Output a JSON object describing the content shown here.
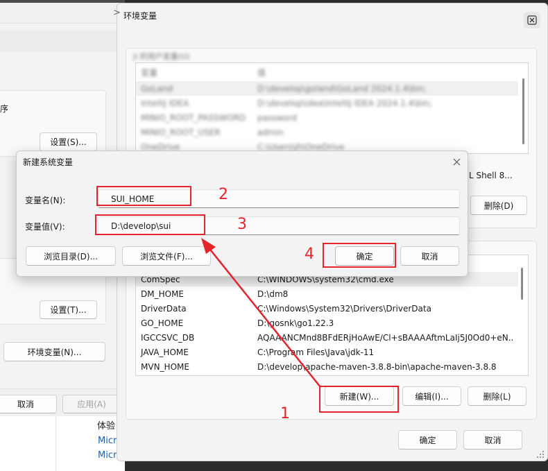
{
  "bg_window": {
    "partial_char": "序",
    "settings_s_label": "设置(S)...",
    "settings_t_label": "设置(T)...",
    "env_vars_label": "环境变量(N)...",
    "cancel_label": "取消",
    "apply_label": "应用(A)"
  },
  "behind_text": {
    "item1": "体验",
    "item2": "Micr",
    "item3": "Micr"
  },
  "env_dialog": {
    "chevron": ">",
    "title": "环境变量",
    "user_group_label": "Ji 的用户变量(U)",
    "user_vars": {
      "col_name": "变量",
      "col_value": "值",
      "rows": [
        {
          "name": "GoLand",
          "value": "D:\\develop\\goland\\GoLand 2024.1.4\\bin;"
        },
        {
          "name": "IntelliJ IDEA",
          "value": "D:\\develop\\idea\\IntelliJ IDEA 2024.1.4\\bin;"
        },
        {
          "name": "MINIO_ROOT_PASSWORD",
          "value": "password"
        },
        {
          "name": "MINIO_ROOT_USER",
          "value": "admin"
        },
        {
          "name": "OneDrive",
          "value": "C:\\Users\\jh\\OneDrive"
        }
      ],
      "partial_row_text": "L Shell 8..."
    },
    "user_delete_label": "删除(D)",
    "sys_vars": {
      "rows": [
        {
          "name": "ComSpec",
          "value": "C:\\WINDOWS\\system32\\cmd.exe"
        },
        {
          "name": "DM_HOME",
          "value": "D:\\dm8"
        },
        {
          "name": "DriverData",
          "value": "C:\\Windows\\System32\\Drivers\\DriverData"
        },
        {
          "name": "GO_HOME",
          "value": "D:\\gosnk\\go1.22.3"
        },
        {
          "name": "IGCCSVC_DB",
          "value": "AQAAANCMnd8BFdERjHoAwE/Cl+sBAAAAftmLaIj5J0Od0+eN..."
        },
        {
          "name": "JAVA_HOME",
          "value": "C:\\Program Files\\Java\\jdk-11"
        },
        {
          "name": "MVN_HOME",
          "value": "D:\\develop\\apache-maven-3.8.8-bin\\apache-maven-3.8.8"
        }
      ]
    },
    "sys_new_label": "新建(W)...",
    "sys_edit_label": "编辑(I)...",
    "sys_delete_label": "删除(L)",
    "ok_label": "确定",
    "cancel_label": "取消"
  },
  "new_var_dialog": {
    "title": "新建系统变量",
    "name_label": "变量名(N):",
    "name_value": "SUI_HOME",
    "value_label": "变量值(V):",
    "value_value": "D:\\develop\\sui",
    "browse_dir_label": "浏览目录(D)...",
    "browse_file_label": "浏览文件(F)...",
    "ok_label": "确定",
    "cancel_label": "取消"
  },
  "annotations": {
    "n1": "1",
    "n2": "2",
    "n3": "3",
    "n4": "4",
    "color": "#e3242b"
  }
}
